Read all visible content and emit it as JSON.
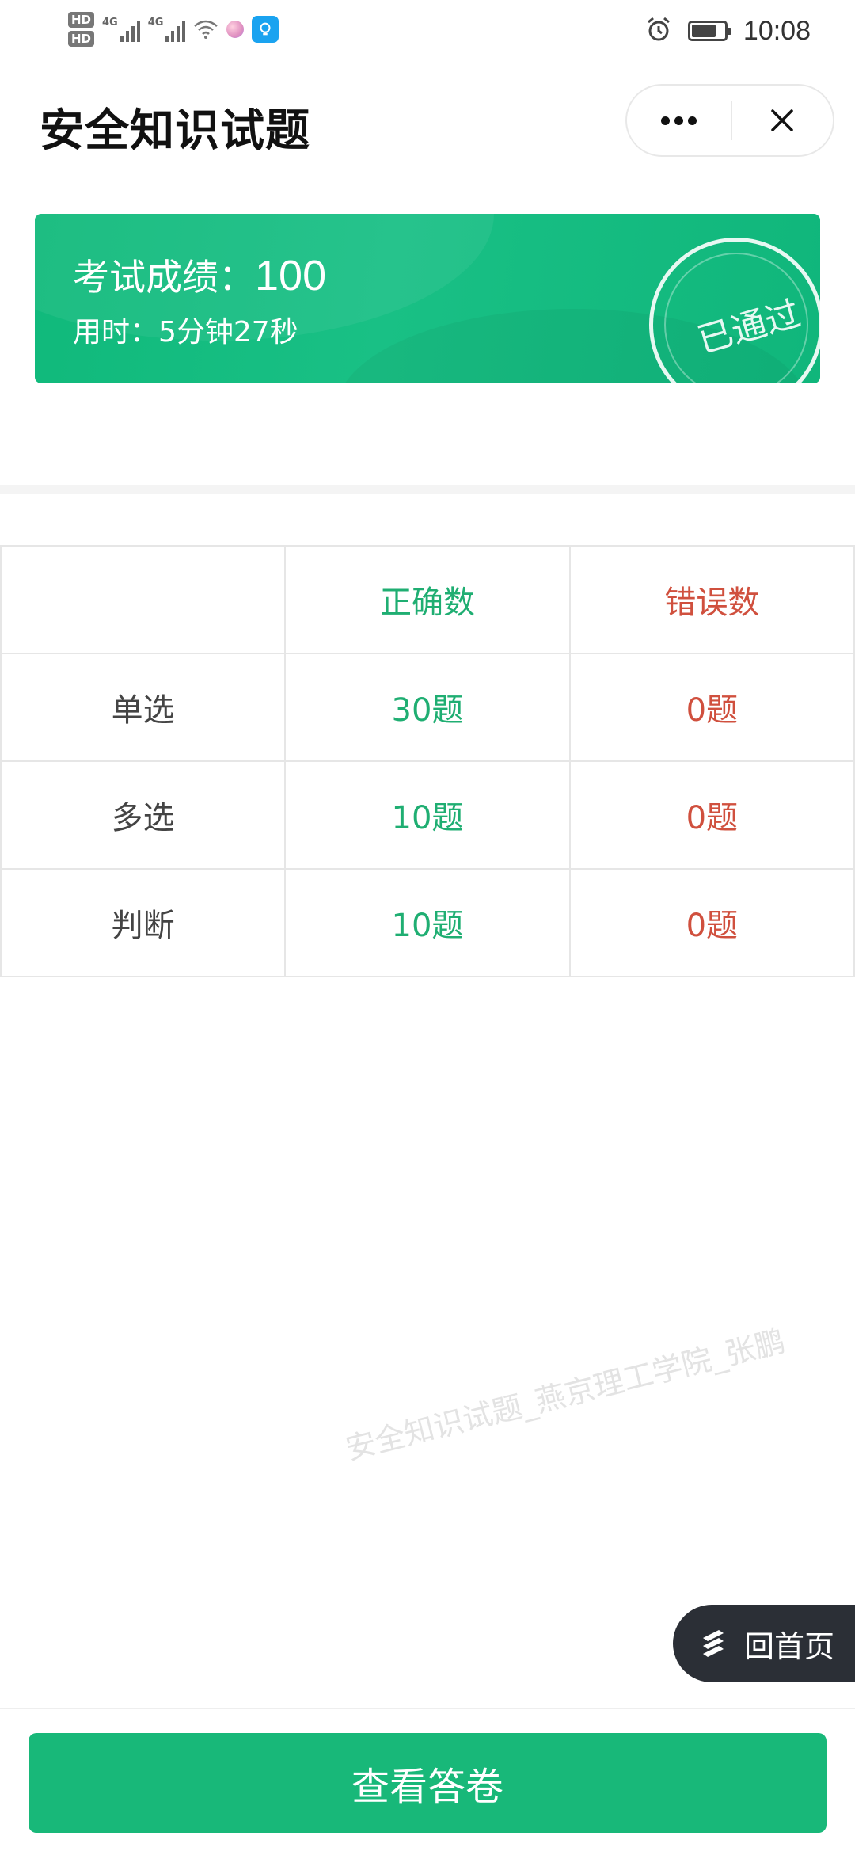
{
  "status_bar": {
    "hd1": "HD",
    "hd2": "HD",
    "sim1_label": "4G",
    "sim2_label": "4G",
    "time": "10:08",
    "battery_level": 0.75,
    "icons": [
      "hd-icon",
      "signal-icon",
      "wifi-icon",
      "app-ball-icon",
      "bulb-icon",
      "alarm-icon",
      "battery-icon"
    ]
  },
  "header": {
    "title": "安全知识试题",
    "more_icon": "more-icon",
    "close_icon": "close-icon"
  },
  "score_card": {
    "score_label": "考试成绩：",
    "score_value": "100",
    "time_text": "用时：5分钟27秒",
    "stamp_text": "已通过",
    "color": "#19c085"
  },
  "results_table": {
    "headers": [
      "",
      "正确数",
      "错误数"
    ],
    "rows": [
      {
        "category": "单选",
        "correct": "30题",
        "wrong": "0题"
      },
      {
        "category": "多选",
        "correct": "10题",
        "wrong": "0题"
      },
      {
        "category": "判断",
        "correct": "10题",
        "wrong": "0题"
      }
    ],
    "correct_color": "#1fae72",
    "wrong_color": "#d0503e"
  },
  "watermark": "安全知识试题_燕京理工学院_张鹏",
  "home_button": {
    "label": "回首页",
    "icon": "home-logo-icon"
  },
  "bottom": {
    "view_answers_label": "查看答卷",
    "button_color": "#18b879"
  }
}
